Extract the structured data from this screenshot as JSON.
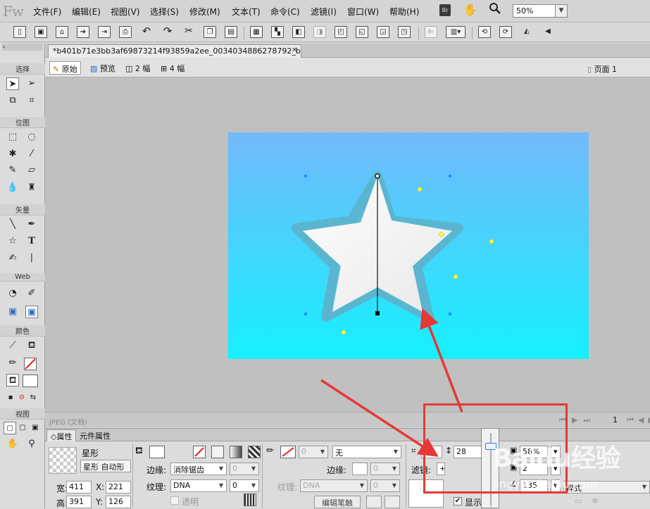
{
  "app": {
    "logo": "Fw",
    "menu": [
      "文件(F)",
      "编辑(E)",
      "视图(V)",
      "选择(S)",
      "修改(M)",
      "文本(T)",
      "命令(C)",
      "滤镜(I)",
      "窗口(W)",
      "帮助(H)"
    ],
    "bridge_badge": "Br",
    "zoom_value": "50%"
  },
  "tools_panel": {
    "headings": {
      "select": "选择",
      "bitmap": "位图",
      "vector": "矢量",
      "web": "Web",
      "colors": "颜色",
      "view": "视图"
    }
  },
  "document": {
    "tab_title": "*b401b71e3bb3af69873214f93859a2ee_0034034886278792_b.jpg",
    "view_modes": [
      "原始",
      "预览",
      "2 幅",
      "4 幅"
    ],
    "page_label": "页面 1",
    "status_label": "JPEG (文档)",
    "page_number": "1"
  },
  "properties": {
    "tabs": [
      "属性",
      "元件属性"
    ],
    "object_type": "星形",
    "object_desc": "星形 自动形",
    "width_label": "宽:",
    "width_value": "411",
    "height_label": "高:",
    "height_value": "391",
    "x_label": "X:",
    "x_value": "221",
    "y_label": "Y:",
    "y_value": "126",
    "fill_edge_label": "边缘:",
    "fill_edge_value": "消除锯齿",
    "fill_edge_amount": "0",
    "texture_label": "纹理:",
    "texture_value": "DNA",
    "texture_amount": "0",
    "transparent_label": "透明",
    "stroke_size": "0",
    "stroke_type": "无",
    "stroke_edge_label": "边缘:",
    "stroke_edge_amount": "0",
    "stroke_texture_label": "纹理:",
    "stroke_texture_value": "DNA",
    "stroke_texture_amount": "0",
    "edit_stroke_button": "编辑笔触",
    "filter_label": "滤镜:",
    "partial_value": "00",
    "roundness_value": "28",
    "opacity_value": "58%",
    "spinner_value": "2",
    "angle_value": "135",
    "show_label": "显示",
    "style_label": "样式"
  },
  "watermark": {
    "text": "Baidu经验",
    "url": "jingyan.baidu.com"
  },
  "colors": {
    "annotation_red": "#e53935",
    "canvas_top": "#74b9fb",
    "canvas_bottom": "#15f0ff"
  }
}
